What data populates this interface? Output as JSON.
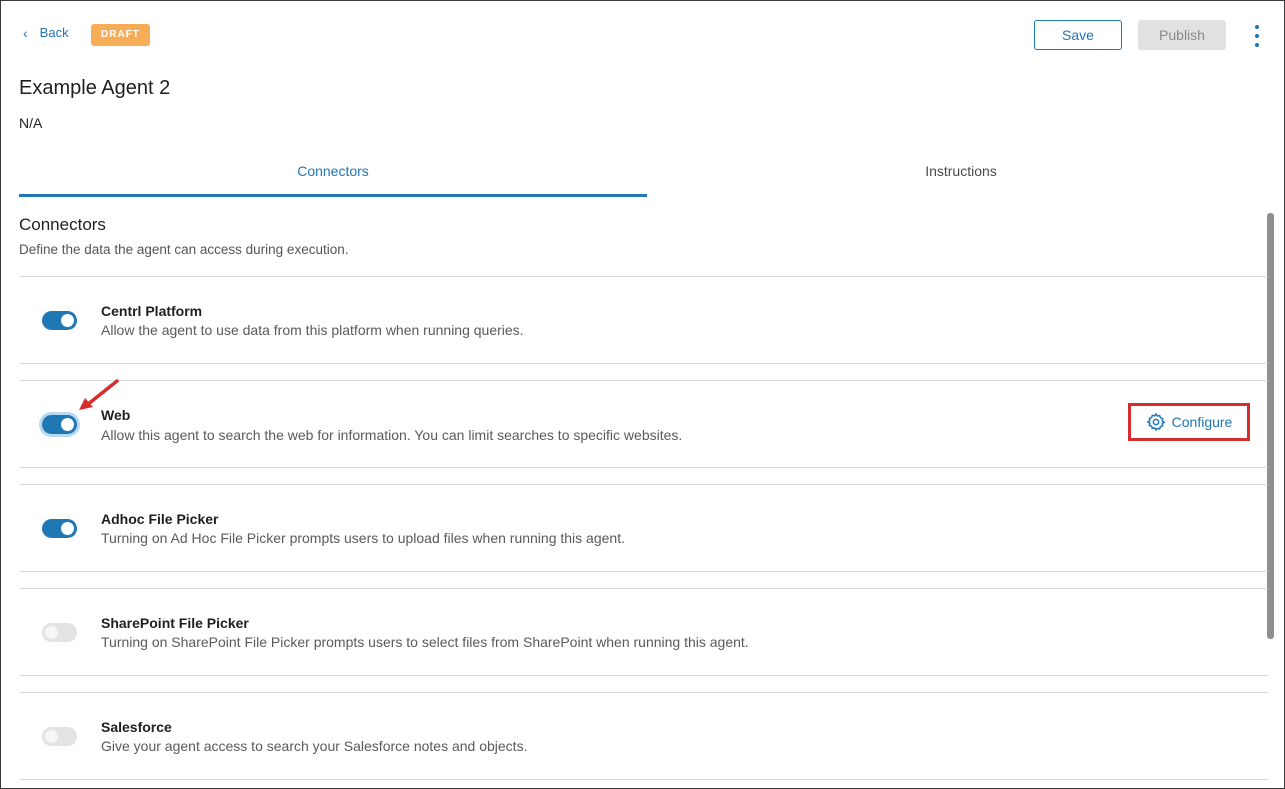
{
  "header": {
    "back_label": "Back",
    "status_badge": "DRAFT",
    "save_label": "Save",
    "publish_label": "Publish"
  },
  "agent": {
    "title": "Example Agent 2",
    "description": "N/A"
  },
  "tabs": [
    {
      "label": "Connectors",
      "active": true
    },
    {
      "label": "Instructions",
      "active": false
    }
  ],
  "section": {
    "title": "Connectors",
    "subtitle": "Define the data the agent can access during execution."
  },
  "connectors": [
    {
      "name": "Centrl Platform",
      "description": "Allow the agent to use data from this platform when running queries.",
      "enabled": true
    },
    {
      "name": "Web",
      "description": "Allow this agent to search the web for information. You can limit searches to specific websites.",
      "enabled": true,
      "action_label": "Configure"
    },
    {
      "name": "Adhoc File Picker",
      "description": "Turning on Ad Hoc File Picker prompts users to upload files when running this agent.",
      "enabled": true
    },
    {
      "name": "SharePoint File Picker",
      "description": "Turning on SharePoint File Picker prompts users to select files from SharePoint when running this agent.",
      "enabled": false
    },
    {
      "name": "Salesforce",
      "description": "Give your agent access to search your Salesforce notes and objects.",
      "enabled": false
    }
  ],
  "colors": {
    "accent": "#1f77b4",
    "draft_badge": "#f6ad55",
    "highlight_annotation": "#d62d2d"
  },
  "icons": [
    "chevron-left-icon",
    "kebab-menu-icon",
    "gear-icon",
    "annotation-arrow-icon"
  ]
}
